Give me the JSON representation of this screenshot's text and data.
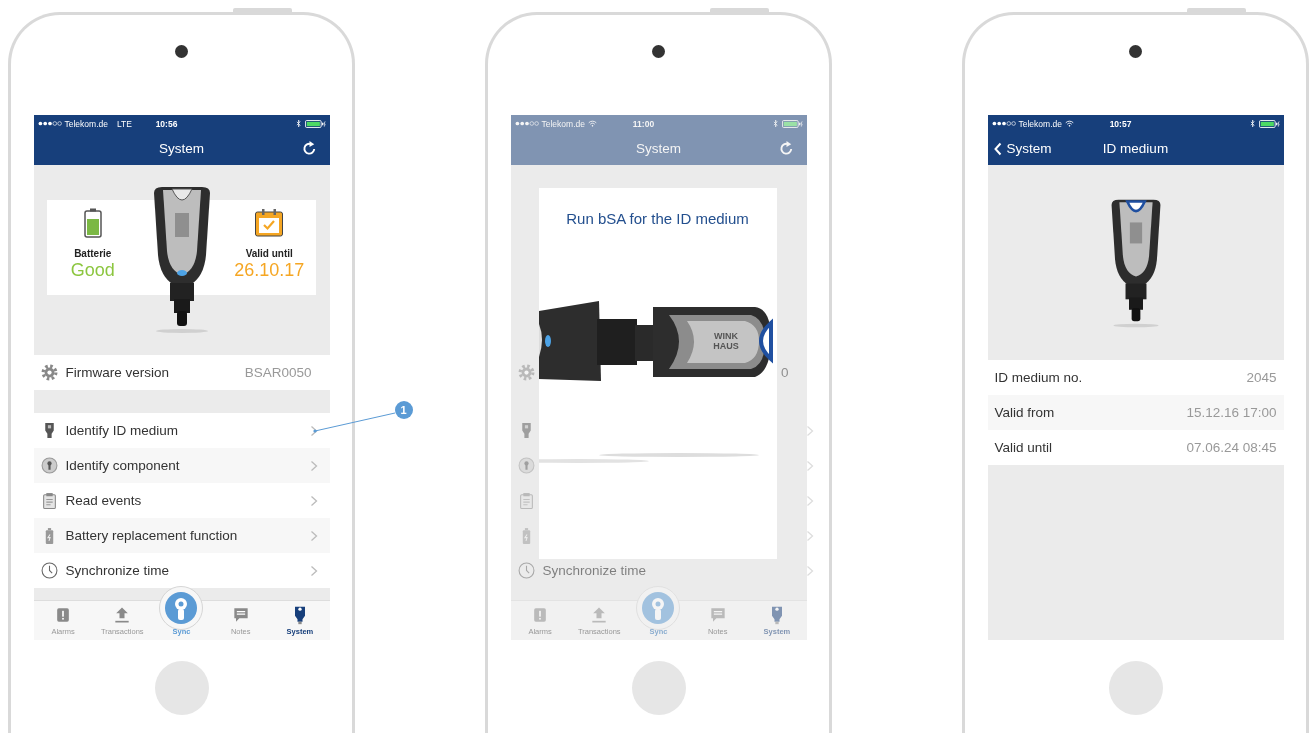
{
  "phones": [
    {
      "kind": "system",
      "status_bar": {
        "carrier": "Telekom.de",
        "network": {
          "kind": "text",
          "label": "LTE"
        },
        "time": "10:56"
      },
      "nav": {
        "title": "System"
      },
      "summary": {
        "battery_label": "Batterie",
        "battery_value": "Good",
        "valid_label": "Valid until",
        "valid_value": "26.10.17"
      },
      "firmware": {
        "label": "Firmware version",
        "value": "BSAR0050"
      },
      "menu": [
        {
          "kind": "key",
          "label": "Identify ID medium",
          "callout": "1"
        },
        {
          "kind": "component",
          "label": "Identify component"
        },
        {
          "kind": "clipboard",
          "label": "Read events"
        },
        {
          "kind": "battery",
          "label": "Battery replacement function"
        },
        {
          "kind": "clock",
          "label": "Synchronize time"
        }
      ],
      "tabs": [
        {
          "kind": "alarm",
          "label": "Alarms",
          "selected": false
        },
        {
          "kind": "upload",
          "label": "Transactions",
          "selected": false
        },
        {
          "kind": "sync",
          "label": "Sync",
          "selected": false
        },
        {
          "kind": "notes",
          "label": "Notes",
          "selected": false
        },
        {
          "kind": "system",
          "label": "System",
          "selected": true
        }
      ]
    },
    {
      "kind": "dialog",
      "status_bar": {
        "carrier": "Telekom.de",
        "network": {
          "kind": "wifi"
        },
        "time": "11:00"
      },
      "nav": {
        "title": "System"
      },
      "firmware": {
        "value": "0"
      },
      "menu": [
        {
          "kind": "key"
        },
        {
          "kind": "component"
        },
        {
          "kind": "clipboard"
        },
        {
          "kind": "battery"
        },
        {
          "kind": "clock",
          "label": "Synchronize time"
        }
      ],
      "tabs": [
        {
          "kind": "alarm",
          "label": "Alarms",
          "selected": false
        },
        {
          "kind": "upload",
          "label": "Transactions",
          "selected": false
        },
        {
          "kind": "sync",
          "label": "Sync",
          "selected": false
        },
        {
          "kind": "notes",
          "label": "Notes",
          "selected": false
        },
        {
          "kind": "system",
          "label": "System",
          "selected": true
        }
      ],
      "dialog": {
        "title": "Run bSA for the ID medium",
        "key_logo": [
          "WINK",
          "HAUS"
        ]
      }
    },
    {
      "kind": "detail",
      "status_bar": {
        "carrier": "Telekom.de",
        "network": {
          "kind": "wifi"
        },
        "time": "10:57"
      },
      "nav": {
        "back": "System",
        "title": "ID medium"
      },
      "rows": [
        {
          "label": "ID medium no.",
          "value": "2045"
        },
        {
          "label": "Valid from",
          "value": "15.12.16 17:00"
        },
        {
          "label": "Valid until",
          "value": "07.06.24 08:45"
        }
      ]
    }
  ]
}
